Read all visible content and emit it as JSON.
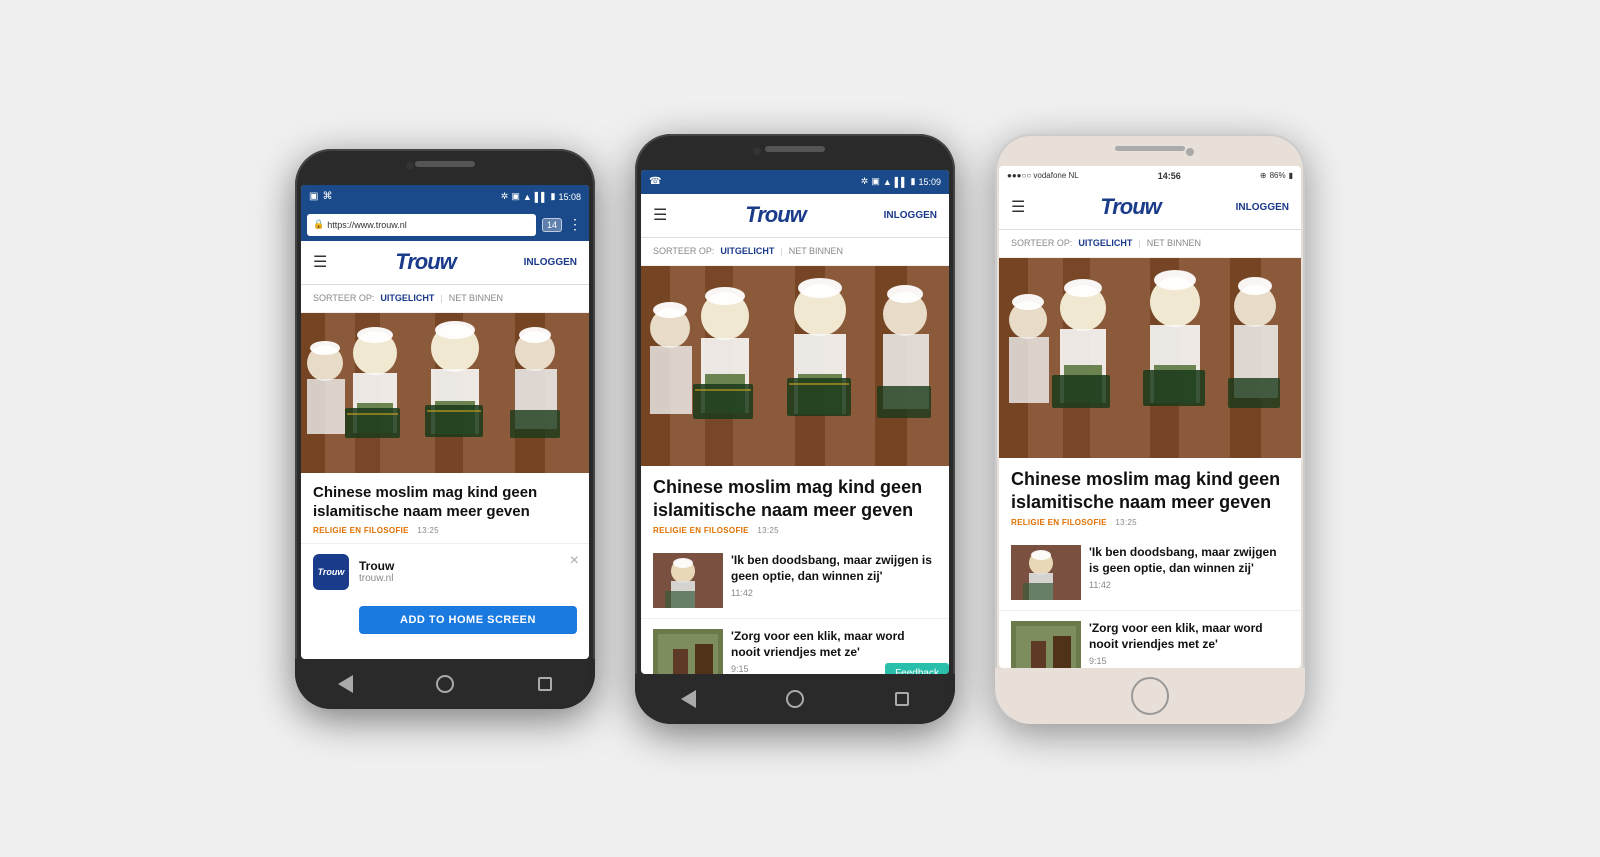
{
  "phones": {
    "android1": {
      "status": {
        "left": "",
        "icons": "🔵 ☞ ▲ ◀ 📶 🔋",
        "time": "15:08"
      },
      "address": "https://www.trouw.nl",
      "tab_count": "14",
      "header": {
        "logo": "Trouw",
        "login": "INLOGGEN"
      },
      "sort": {
        "label": "SORTEER OP:",
        "active": "UITGELICHT",
        "divider": "|",
        "option2": "NET BINNEN"
      },
      "news": {
        "headline": "Chinese moslim mag kind geen islamitische naam meer geven",
        "category": "RELIGIE EN FILOSOFIE",
        "time": "13:25"
      },
      "a2hs": {
        "icon_text": "Trouw",
        "title": "Trouw",
        "url": "trouw.nl",
        "close": "×",
        "button": "ADD TO HOME SCREEN"
      },
      "navbar": {
        "back": "◁",
        "home": "○",
        "recents": "□"
      }
    },
    "android2": {
      "status": {
        "time": "15:09"
      },
      "header": {
        "logo": "Trouw",
        "login": "INLOGGEN"
      },
      "sort": {
        "label": "SORTEER OP:",
        "active": "UITGELICHT",
        "divider": "|",
        "option2": "NET BINNEN"
      },
      "news": {
        "headline": "Chinese moslim mag kind geen islamitische naam meer geven",
        "category": "RELIGIE EN FILOSOFIE",
        "time": "13:25"
      },
      "small_news": [
        {
          "headline": "'Ik ben doodsbang, maar zwijgen is geen optie, dan winnen zij'",
          "time": "11:42"
        },
        {
          "headline": "'Zorg voor een klik, maar word nooit vriendjes met ze'",
          "time": "9:15"
        }
      ],
      "feedback": "Feedback"
    },
    "iphone": {
      "status": {
        "carrier": "●●●○○ vodafone NL",
        "wifi": "▲",
        "time": "14:56",
        "gps": "⊕",
        "battery": "86%"
      },
      "header": {
        "logo": "Trouw",
        "login": "INLOGGEN"
      },
      "sort": {
        "label": "SORTEER OP:",
        "active": "UITGELICHT",
        "divider": "|",
        "option2": "NET BINNEN"
      },
      "news": {
        "headline": "Chinese moslim mag kind geen islamitische naam meer geven",
        "category": "RELIGIE EN FILOSOFIE",
        "time": "13:25"
      },
      "small_news": [
        {
          "headline": "'Ik ben doodsbang, maar zwijgen is geen optie, dan winnen zij'",
          "time": "11:42"
        },
        {
          "headline": "'Zorg voor een klik, maar word nooit vriendjes met ze'",
          "time": "9:15"
        }
      ]
    }
  }
}
